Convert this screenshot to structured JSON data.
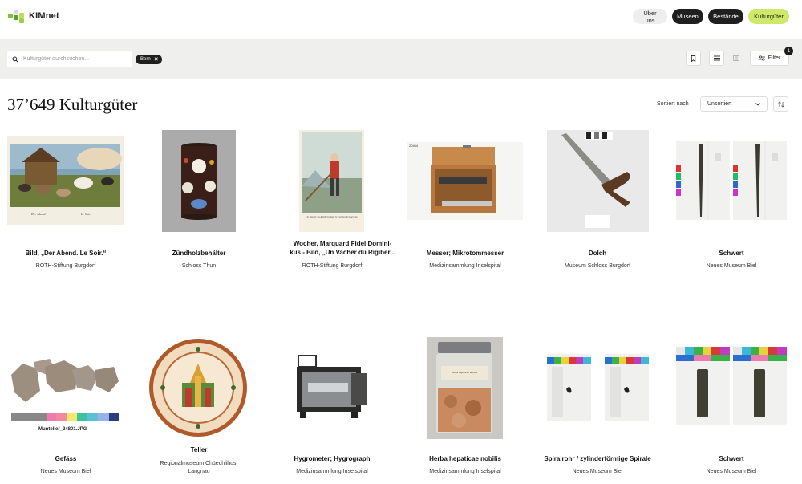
{
  "header": {
    "brand": "KIMnet",
    "nav": [
      "Über uns",
      "Museen",
      "Bestände",
      "Kulturgüter"
    ]
  },
  "search": {
    "placeholder": "Kulturgüter durchsuchen...",
    "chip_label": "Bern",
    "filter_label": "Filter",
    "filter_count": "1"
  },
  "results": {
    "count_title": "37’649 Kulturgüter",
    "sort_label": "Sortiert nach",
    "sort_value": "Unsortiert"
  },
  "items": [
    {
      "title": "Bild, „Der Abend. Le Soir.“",
      "title2": "",
      "owner": "ROTH-Stiftung Burgdorf",
      "owner2": ""
    },
    {
      "title": "Zündholzbehälter",
      "title2": "",
      "owner": "Schloss Thun",
      "owner2": ""
    },
    {
      "title": "Wocher, Marquard Fidel Domini-",
      "title2": "kus - Bild, „Un Vacher du Rigiber...",
      "owner": "ROTH-Stiftung Burgdorf",
      "owner2": ""
    },
    {
      "title": "Messer; Mikrotommesser",
      "title2": "",
      "owner": "Medizinsammlung Inselspital",
      "owner2": ""
    },
    {
      "title": "Dolch",
      "title2": "",
      "owner": "Museum Schloss Burgdorf",
      "owner2": ""
    },
    {
      "title": "Schwert",
      "title2": "",
      "owner": "Neues Museum Biel",
      "owner2": ""
    },
    {
      "title": "Gefäss",
      "title2": "",
      "owner": "Neues Museum Biel",
      "owner2": ""
    },
    {
      "title": "Teller",
      "title2": "",
      "owner": "Regionalmuseum Chüechlihus,",
      "owner2": "Langnau"
    },
    {
      "title": "Hygrometer; Hygrograph",
      "title2": "",
      "owner": "Medizinsammlung Inselspital",
      "owner2": ""
    },
    {
      "title": "Herba hepaticae nobilis",
      "title2": "",
      "owner": "Medizinsammlung Inselspital",
      "owner2": ""
    },
    {
      "title": "Spiralrohr / zylinderförmige Spirale",
      "title2": "",
      "owner": "Neues Museum Biel",
      "owner2": ""
    },
    {
      "title": "Schwert",
      "title2": "",
      "owner": "Neues Museum Biel",
      "owner2": ""
    }
  ],
  "image_captions": {
    "painting1_a": "Der Abend.",
    "painting1_b": "Le Soir.",
    "painting2": "Un Vacher du Rigiberg dans le Canton de Lucerne",
    "sherd": "Muntelier_24801.JPG",
    "knife_tag": "20464",
    "jar_label": "Herba hepaticae nobilis"
  },
  "colors": {
    "accent_lime": "#cde96a",
    "dark": "#1f1f1f",
    "band": "#efefed"
  }
}
